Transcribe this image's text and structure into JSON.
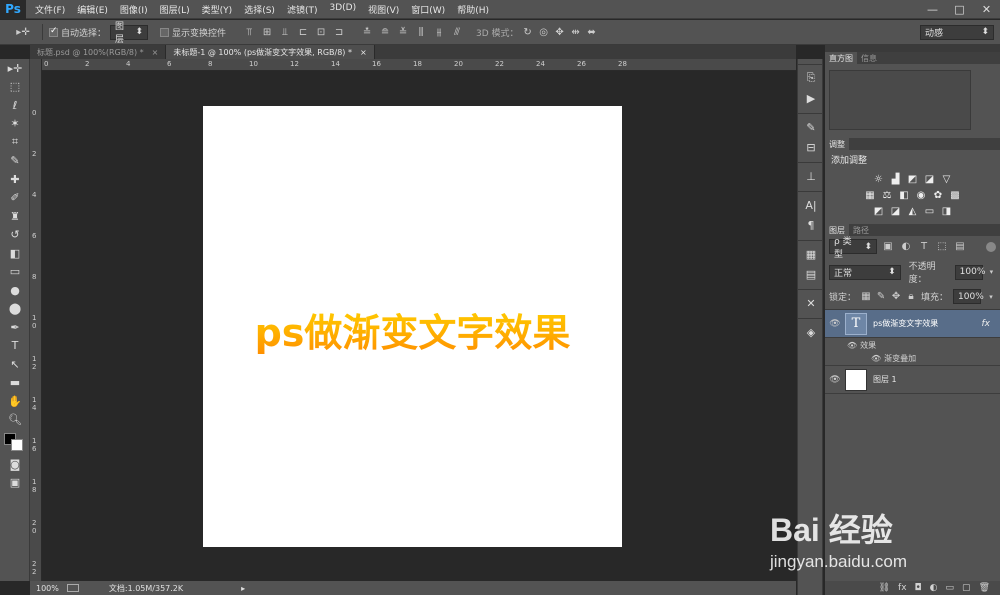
{
  "app": {
    "logo": "Ps"
  },
  "menu": [
    "文件(F)",
    "编辑(E)",
    "图像(I)",
    "图层(L)",
    "类型(Y)",
    "选择(S)",
    "滤镜(T)",
    "3D(D)",
    "视图(V)",
    "窗口(W)",
    "帮助(H)"
  ],
  "window_controls": {
    "minimize": "—",
    "maximize": "□",
    "close": "✕"
  },
  "options": {
    "auto_select_label": "自动选择：",
    "auto_select_value": "图层",
    "transform_label": "显示变换控件",
    "mode_3d_label": "3D 模式：",
    "workspace": "动感"
  },
  "tabs": [
    {
      "label": "标题.psd @ 100%(RGB/8) *",
      "close": "×"
    },
    {
      "label": "未标题-1 @ 100% (ps做渐变文字效果, RGB/8) *",
      "close": "×"
    }
  ],
  "ruler_top": [
    "0",
    "2",
    "4",
    "6",
    "8",
    "10",
    "12",
    "14",
    "16",
    "18",
    "20",
    "22",
    "24",
    "26",
    "28"
  ],
  "ruler_left": [
    "0",
    "2",
    "4",
    "6",
    "8",
    "1 0",
    "1 2",
    "1 4",
    "1 6",
    "1 8",
    "2 0",
    "2 2"
  ],
  "canvas": {
    "text": "ps做渐变文字效果",
    "gradient_colors": [
      "#ffd200",
      "#ffb400",
      "#ff8c00"
    ]
  },
  "status": {
    "zoom": "100%",
    "doc": "文档:1.05M/357.2K"
  },
  "panels": {
    "histogram_tabs": [
      "直方图",
      "信息"
    ],
    "adjust_tab": "调整",
    "adjust_title": "添加调整",
    "layers_tabs": [
      "图层",
      "路径"
    ],
    "filter_kind": "ρ 类型",
    "blend_mode": "正常",
    "opacity_label": "不透明度：",
    "opacity_value": "100%",
    "lock_label": "锁定：",
    "fill_label": "填充：",
    "fill_value": "100%",
    "layers": [
      {
        "name": "ps做渐变文字效果",
        "thumb": "T",
        "fx": "fx",
        "effects_label": "效果",
        "effect": "渐变叠加"
      },
      {
        "name": "图层 1"
      }
    ]
  },
  "watermark": {
    "brand": "Bai 经验",
    "url": "jingyan.baidu.com"
  }
}
